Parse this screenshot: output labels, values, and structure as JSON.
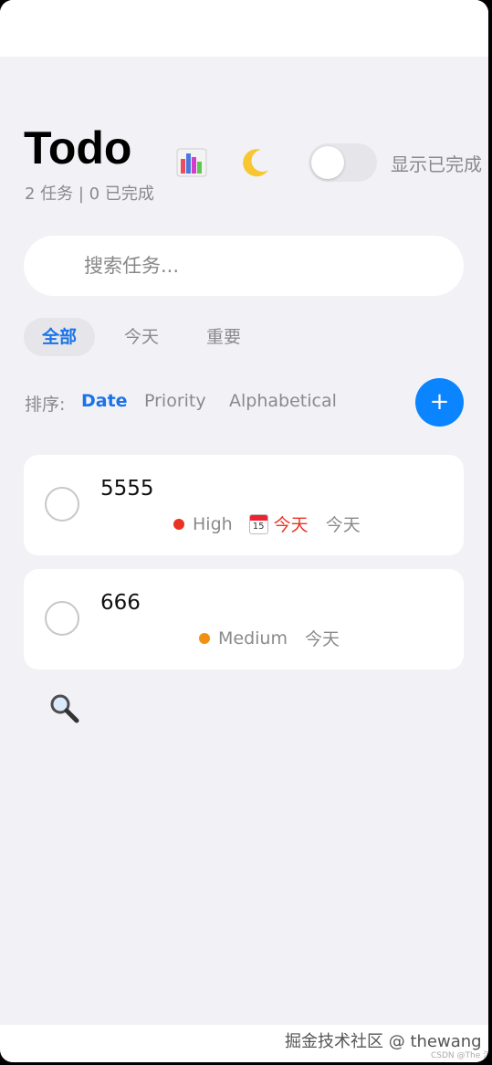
{
  "header": {
    "title": "Todo",
    "subtitle": "2 任务 | 0 已完成",
    "stats_icon": "bar-chart-icon",
    "theme_icon": "crescent-moon-icon",
    "show_completed_label": "显示已完成",
    "show_completed_on": false
  },
  "search": {
    "value": "",
    "placeholder": "搜索任务..."
  },
  "filters": [
    {
      "label": "全部",
      "active": true
    },
    {
      "label": "今天",
      "active": false
    },
    {
      "label": "重要",
      "active": false
    }
  ],
  "sort": {
    "label": "排序:",
    "options": [
      {
        "label": "Date",
        "active": true
      },
      {
        "label": "Priority",
        "active": false
      },
      {
        "label": "Alphabetical",
        "active": false
      }
    ],
    "add_label": "+"
  },
  "tasks": [
    {
      "title": "5555",
      "priority": "High",
      "priority_color": "#ea3323",
      "due_label": "今天",
      "date_label": "今天",
      "calendar_day": "15"
    },
    {
      "title": "666",
      "priority": "Medium",
      "priority_color": "#f0920f",
      "date_label": "今天"
    }
  ],
  "colors": {
    "accent": "#0a84ff",
    "active_text": "#1a73e8",
    "background": "#f2f1f6"
  },
  "footer": {
    "watermark": "掘金技术社区 @ thewang",
    "small_watermark": "CSDN @The 沉"
  }
}
